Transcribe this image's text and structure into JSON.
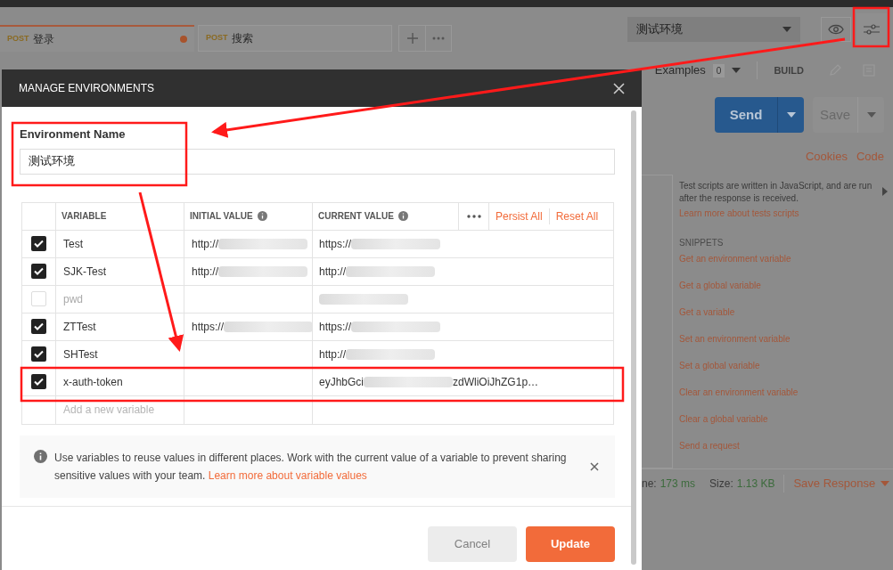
{
  "app": {
    "tabs": [
      {
        "method": "POST",
        "title": "登录",
        "selected": true,
        "unsaved": true
      },
      {
        "method": "POST",
        "title": "搜索",
        "selected": false,
        "unsaved": false
      }
    ],
    "environment_select": "测试环境",
    "examples": {
      "label": "Examples",
      "count": "0"
    },
    "build": "BUILD",
    "send": "Send",
    "save": "Save",
    "links": [
      "Cookies",
      "Code"
    ],
    "tests_help": "Test scripts are written in JavaScript, and are run after the response is received.",
    "tests_link": "Learn more about tests scripts",
    "snippets_title": "SNIPPETS",
    "snippets": [
      "Get an environment variable",
      "Get a global variable",
      "Get a variable",
      "Set an environment variable",
      "Set a global variable",
      "Clear an environment variable",
      "Clear a global variable",
      "Send a request"
    ],
    "status": {
      "time_label": "ne:",
      "time": "173 ms",
      "size_label": "Size:",
      "size": "1.13 KB",
      "save_response": "Save Response"
    }
  },
  "modal": {
    "title": "MANAGE ENVIRONMENTS",
    "name_label": "Environment Name",
    "name_value": "测试环境",
    "columns": [
      "VARIABLE",
      "INITIAL VALUE",
      "CURRENT VALUE"
    ],
    "persist_all": "Persist All",
    "reset_all": "Reset All",
    "rows": [
      {
        "enabled": true,
        "variable": "Test",
        "initial_value": {
          "text": "http://",
          "redacted": true
        },
        "current_value": {
          "text": "https://",
          "redacted": true
        }
      },
      {
        "enabled": true,
        "variable": "SJK-Test",
        "initial_value": {
          "text": "http://",
          "redacted": true
        },
        "current_value": {
          "text": "http://",
          "redacted": true
        }
      },
      {
        "enabled": false,
        "variable": "pwd",
        "current_value": {
          "redacted": true
        }
      },
      {
        "enabled": true,
        "variable": "ZTTest",
        "initial_value": {
          "text": "https://",
          "redacted": true
        },
        "current_value": {
          "text": "https://",
          "redacted": true
        }
      },
      {
        "enabled": true,
        "variable": "SHTest",
        "current_value": {
          "text": "http://",
          "redacted": true
        }
      },
      {
        "enabled": true,
        "variable": "x-auth-token",
        "current_value": {
          "text": "eyJhbGci",
          "redacted": true,
          "tail": "zdWliOiJhZG1p…"
        }
      }
    ],
    "add_placeholder": "Add a new variable",
    "info": "Use variables to reuse values in different places. Work with the current value of a variable to prevent sharing sensitive values with your team.",
    "info_link": "Learn more about variable values",
    "cancel": "Cancel",
    "update": "Update"
  }
}
